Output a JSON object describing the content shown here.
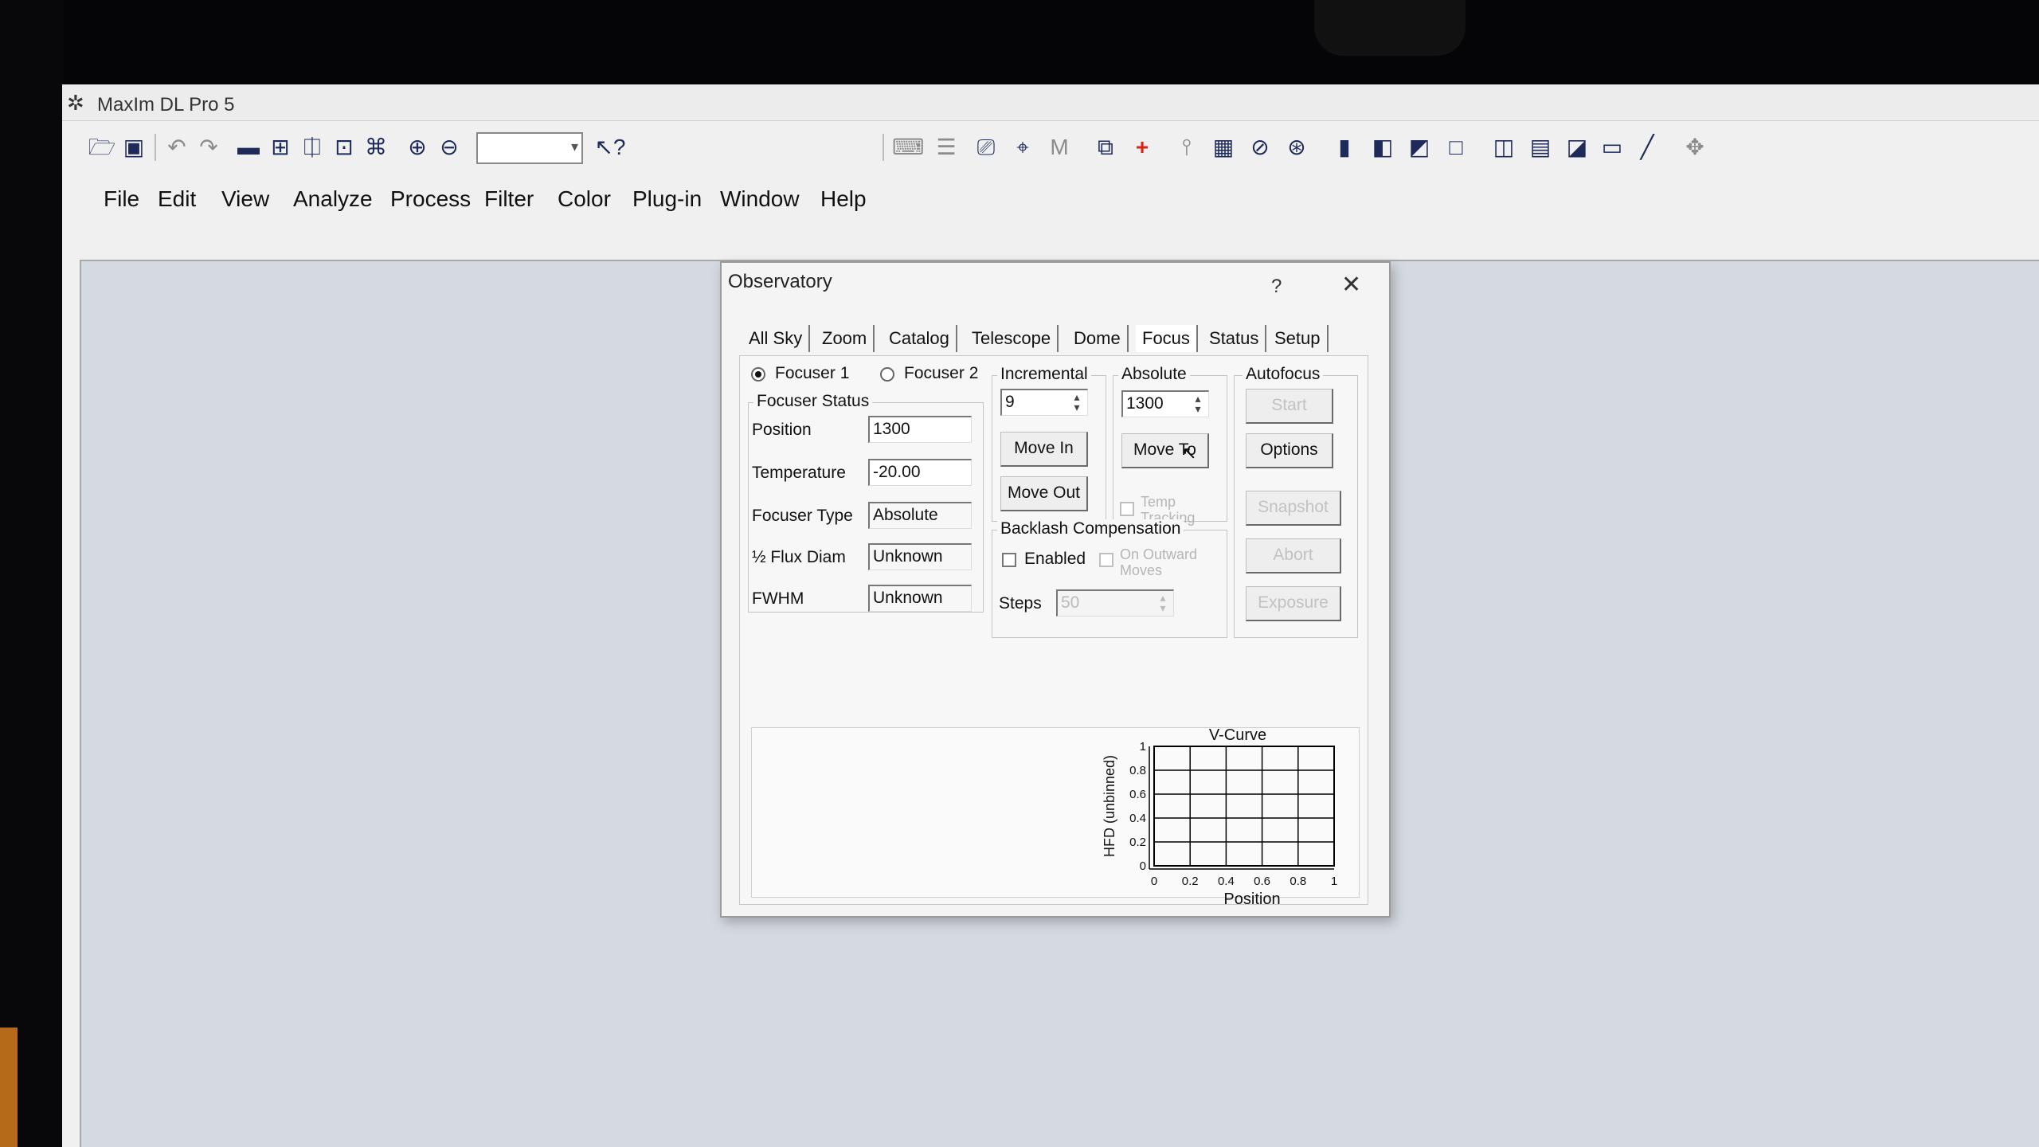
{
  "app": {
    "title": "MaxIm DL Pro 5",
    "icon": "satellite-icon",
    "menu": [
      "File",
      "Edit",
      "View",
      "Analyze",
      "Process",
      "Filter",
      "Color",
      "Plug-in",
      "Window",
      "Help"
    ],
    "toolbar_icons": [
      "open-folder-icon",
      "save-icon",
      "undo-icon",
      "redo-icon",
      "image-icon",
      "screen-stretch-icon",
      "flip-icon",
      "lock-icon",
      "settings-icon",
      "zoom-in-icon",
      "zoom-out-icon",
      "zoom-combo",
      "context-help-icon"
    ],
    "zoom_value": ""
  },
  "dialog": {
    "title": "Observatory",
    "help_glyph": "?",
    "close_glyph": "✕",
    "tabs": [
      "All Sky",
      "Zoom",
      "Catalog",
      "Telescope",
      "Dome",
      "Focus",
      "Status",
      "Setup"
    ],
    "active_tab": "Focus",
    "focuser_1": "Focuser 1",
    "focuser_2": "Focuser 2",
    "focuser_status": {
      "title": "Focuser Status",
      "position_label": "Position",
      "position_value": "1300",
      "temperature_label": "Temperature",
      "temperature_value": "-20.00",
      "type_label": "Focuser Type",
      "type_value": "Absolute",
      "flux_label": "½ Flux Diam",
      "flux_value": "Unknown",
      "fwhm_label": "FWHM",
      "fwhm_value": "Unknown"
    },
    "incremental": {
      "title": "Incremental",
      "value": "9",
      "move_in": "Move In",
      "move_out": "Move Out"
    },
    "absolute": {
      "title": "Absolute",
      "value": "1300",
      "move_to": "Move To",
      "temp_tracking": "Temp Tracking"
    },
    "autofocus": {
      "title": "Autofocus",
      "start": "Start",
      "options": "Options",
      "snapshot": "Snapshot",
      "abort": "Abort",
      "exposure": "Exposure"
    },
    "backlash": {
      "title": "Backlash Compensation",
      "enabled": "Enabled",
      "on_outward": "On Outward Moves",
      "steps_label": "Steps",
      "steps_value": "50"
    }
  },
  "chart_data": {
    "type": "line",
    "title": "V-Curve",
    "xlabel": "Position",
    "ylabel": "HFD (unbinned)",
    "xlim": [
      0,
      1
    ],
    "ylim": [
      0,
      1
    ],
    "x_ticks": [
      "0",
      "0.2",
      "0.4",
      "0.6",
      "0.8",
      "1"
    ],
    "y_ticks": [
      "0",
      "0.2",
      "0.4",
      "0.6",
      "0.8",
      "1"
    ],
    "grid": true,
    "series": []
  }
}
